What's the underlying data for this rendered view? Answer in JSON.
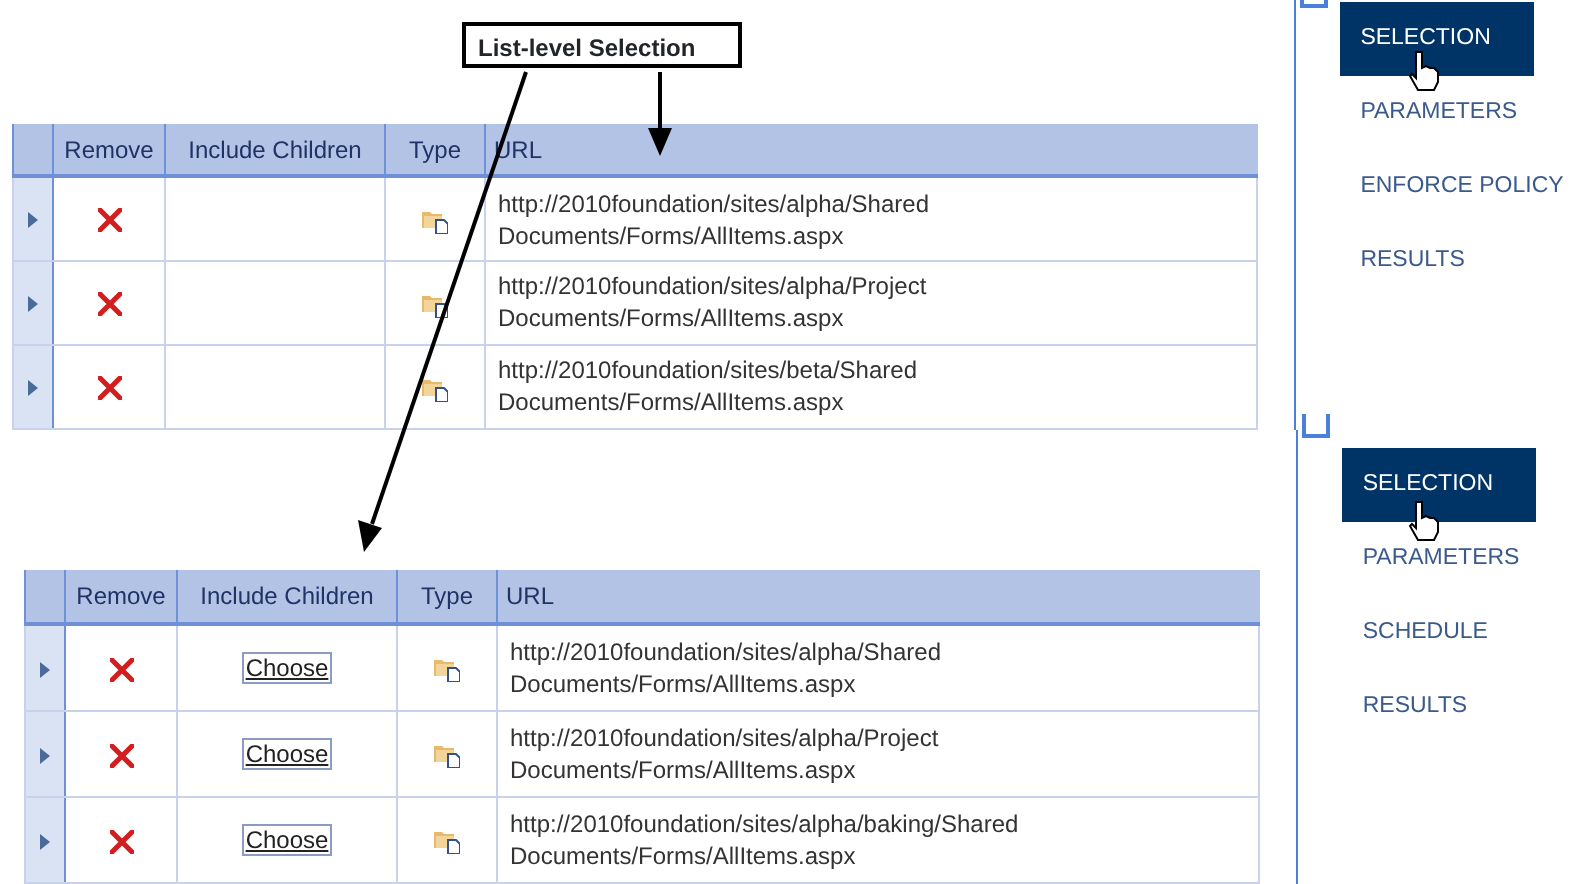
{
  "annotation": {
    "label": "List-level Selection"
  },
  "panels": [
    {
      "table": {
        "columns": [
          "Remove",
          "Include Children",
          "Type",
          "URL"
        ],
        "rows": [
          {
            "url": "http://2010foundation/sites/alpha/Shared Documents/Forms/AllItems.aspx"
          },
          {
            "url": "http://2010foundation/sites/alpha/Project Documents/Forms/AllItems.aspx"
          },
          {
            "url": "http://2010foundation/sites/beta/Shared Documents/Forms/AllItems.aspx"
          }
        ]
      },
      "nav": [
        {
          "label": "SELECTION",
          "selected": true
        },
        {
          "label": "PARAMETERS",
          "selected": false
        },
        {
          "label": "ENFORCE POLICY",
          "selected": false
        },
        {
          "label": "RESULTS",
          "selected": false
        }
      ]
    },
    {
      "table": {
        "columns": [
          "Remove",
          "Include Children",
          "Type",
          "URL"
        ],
        "rows": [
          {
            "url": "http://2010foundation/sites/alpha/Shared Documents/Forms/AllItems.aspx",
            "include_children": "Choose"
          },
          {
            "url": "http://2010foundation/sites/alpha/Project Documents/Forms/AllItems.aspx",
            "include_children": "Choose"
          },
          {
            "url": "http://2010foundation/sites/alpha/baking/Shared Documents/Forms/AllItems.aspx",
            "include_children": "Choose"
          }
        ]
      },
      "nav": [
        {
          "label": "SELECTION",
          "selected": true
        },
        {
          "label": "PARAMETERS",
          "selected": false
        },
        {
          "label": "SCHEDULE",
          "selected": false
        },
        {
          "label": "RESULTS",
          "selected": false
        }
      ]
    }
  ]
}
